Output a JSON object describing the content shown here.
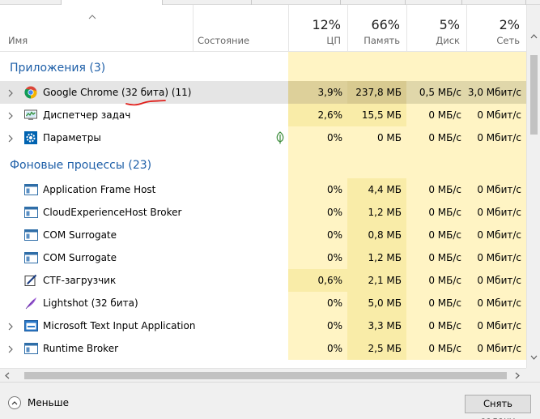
{
  "columns": {
    "name": "Имя",
    "status": "Состояние",
    "cpu": {
      "pct": "12%",
      "label": "ЦП"
    },
    "memory": {
      "pct": "66%",
      "label": "Память"
    },
    "disk": {
      "pct": "5%",
      "label": "Диск"
    },
    "network": {
      "pct": "2%",
      "label": "Сеть"
    }
  },
  "groups": [
    {
      "title": "Приложения (3)",
      "rows": [
        {
          "name": "Google Chrome (32 бита) (11)",
          "icon": "chrome-icon",
          "expandable": true,
          "selected": true,
          "status_icon": "",
          "cpu": "3,9%",
          "memory": "237,8 МБ",
          "disk": "0,5 МБ/с",
          "network": "3,0 Мбит/с"
        },
        {
          "name": "Диспетчер задач",
          "icon": "task-manager-icon",
          "expandable": true,
          "selected": false,
          "status_icon": "",
          "cpu": "2,6%",
          "memory": "15,5 МБ",
          "disk": "0 МБ/с",
          "network": "0 Мбит/с"
        },
        {
          "name": "Параметры",
          "icon": "settings-gear-icon",
          "expandable": true,
          "selected": false,
          "status_icon": "leaf-icon",
          "cpu": "0%",
          "memory": "0 МБ",
          "disk": "0 МБ/с",
          "network": "0 Мбит/с"
        }
      ]
    },
    {
      "title": "Фоновые процессы (23)",
      "rows": [
        {
          "name": "Application Frame Host",
          "icon": "app-window-icon",
          "expandable": false,
          "selected": false,
          "status_icon": "",
          "cpu": "0%",
          "memory": "4,4 МБ",
          "disk": "0 МБ/с",
          "network": "0 Мбит/с"
        },
        {
          "name": "CloudExperienceHost Broker",
          "icon": "app-window-icon",
          "expandable": false,
          "selected": false,
          "status_icon": "",
          "cpu": "0%",
          "memory": "1,2 МБ",
          "disk": "0 МБ/с",
          "network": "0 Мбит/с"
        },
        {
          "name": "COM Surrogate",
          "icon": "app-window-icon",
          "expandable": false,
          "selected": false,
          "status_icon": "",
          "cpu": "0%",
          "memory": "0,8 МБ",
          "disk": "0 МБ/с",
          "network": "0 Мбит/с"
        },
        {
          "name": "COM Surrogate",
          "icon": "app-window-icon",
          "expandable": false,
          "selected": false,
          "status_icon": "",
          "cpu": "0%",
          "memory": "1,2 МБ",
          "disk": "0 МБ/с",
          "network": "0 Мбит/с"
        },
        {
          "name": "CTF-загрузчик",
          "icon": "ctf-pen-icon",
          "expandable": false,
          "selected": false,
          "status_icon": "",
          "cpu": "0,6%",
          "memory": "2,1 МБ",
          "disk": "0 МБ/с",
          "network": "0 Мбит/с"
        },
        {
          "name": "Lightshot (32 бита)",
          "icon": "lightshot-feather-icon",
          "expandable": false,
          "selected": false,
          "status_icon": "",
          "cpu": "0%",
          "memory": "5,0 МБ",
          "disk": "0 МБ/с",
          "network": "0 Мбит/с"
        },
        {
          "name": "Microsoft Text Input Application",
          "icon": "app-window-blue-icon",
          "expandable": true,
          "selected": false,
          "status_icon": "",
          "cpu": "0%",
          "memory": "3,3 МБ",
          "disk": "0 МБ/с",
          "network": "0 Мбит/с"
        },
        {
          "name": "Runtime Broker",
          "icon": "app-window-icon",
          "expandable": true,
          "selected": false,
          "status_icon": "",
          "cpu": "0%",
          "memory": "2,5 МБ",
          "disk": "0 МБ/с",
          "network": "0 Мбит/с"
        }
      ]
    }
  ],
  "footer": {
    "less_label": "Меньше",
    "end_task_label": "Снять задачу"
  },
  "colors": {
    "group_title": "#1e5fa8",
    "cell_bg": "#fff4c4",
    "selected_row": "#e5e5e5",
    "annotation_underline": "#e0201c"
  }
}
